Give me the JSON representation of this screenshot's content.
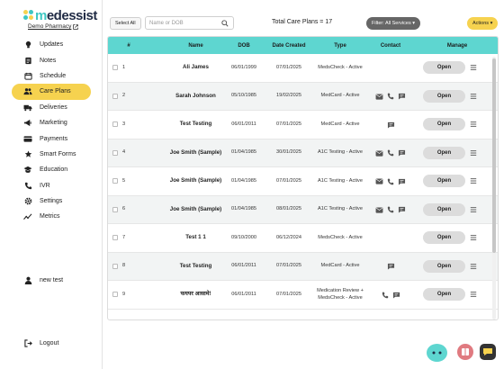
{
  "brand": {
    "logo_prefix": "m",
    "logo_rest": "edessist",
    "pharmacy": "Demo Pharmacy"
  },
  "sidebar": {
    "items": [
      {
        "label": "Updates",
        "icon": "bulb-icon"
      },
      {
        "label": "Notes",
        "icon": "notes-icon"
      },
      {
        "label": "Schedule",
        "icon": "calendar-icon"
      },
      {
        "label": "Care Plans",
        "icon": "people-icon",
        "active": true
      },
      {
        "label": "Deliveries",
        "icon": "truck-icon"
      },
      {
        "label": "Marketing",
        "icon": "megaphone-icon"
      },
      {
        "label": "Payments",
        "icon": "payment-icon"
      },
      {
        "label": "Smart Forms",
        "icon": "forms-icon"
      },
      {
        "label": "Education",
        "icon": "graduation-icon"
      },
      {
        "label": "IVR",
        "icon": "phone-icon"
      },
      {
        "label": "Settings",
        "icon": "gear-icon"
      },
      {
        "label": "Metrics",
        "icon": "metrics-icon"
      }
    ],
    "user": "new test",
    "logout": "Logout"
  },
  "toolbar": {
    "select_all": "Select All",
    "search_placeholder": "Name or DOB",
    "total": "Total Care Plans = 17",
    "filter": "Filter: All Services ▾",
    "actions": "Actions ▾"
  },
  "table": {
    "headers": [
      "#",
      "Name",
      "DOB",
      "Date Created",
      "Type",
      "Contact",
      "Manage"
    ],
    "open_label": "Open",
    "rows": [
      {
        "num": "1",
        "name": "Ali James",
        "dob": "06/01/1999",
        "created": "07/01/2025",
        "type": "MedsCheck - Active",
        "contact": []
      },
      {
        "num": "2",
        "name": "Sarah Johnson",
        "dob": "05/10/1985",
        "created": "19/02/2025",
        "type": "MedCard - Active",
        "contact": [
          "mail",
          "phone",
          "chat"
        ]
      },
      {
        "num": "3",
        "name": "Test Testing",
        "dob": "06/01/2011",
        "created": "07/01/2025",
        "type": "MedCard - Active",
        "contact": [
          "chat"
        ]
      },
      {
        "num": "4",
        "name": "Joe Smith (Sample)",
        "dob": "01/04/1985",
        "created": "30/01/2025",
        "type": "A1C Testing - Active",
        "contact": [
          "mail",
          "phone",
          "chat"
        ]
      },
      {
        "num": "5",
        "name": "Joe Smith (Sample)",
        "dob": "01/04/1985",
        "created": "07/01/2025",
        "type": "A1C Testing - Active",
        "contact": [
          "mail",
          "phone",
          "chat"
        ]
      },
      {
        "num": "6",
        "name": "Joe Smith (Sample)",
        "dob": "01/04/1985",
        "created": "08/01/2025",
        "type": "A1C Testing - Active",
        "contact": [
          "mail",
          "phone",
          "chat"
        ]
      },
      {
        "num": "7",
        "name": "Test 1 1",
        "dob": "09/10/2000",
        "created": "06/12/2024",
        "type": "MedsCheck - Active",
        "contact": []
      },
      {
        "num": "8",
        "name": "Test Testing",
        "dob": "06/01/2011",
        "created": "07/01/2025",
        "type": "MedCard - Active",
        "contact": [
          "chat"
        ]
      },
      {
        "num": "9",
        "name": "फयपर आसामे!",
        "dob": "06/01/2011",
        "created": "07/01/2025",
        "type": "Medication Review + MedsCheck - Active",
        "contact": [
          "phone",
          "chat"
        ]
      }
    ]
  },
  "colors": {
    "accent_teal": "#5ed6d0",
    "accent_yellow": "#f6d24f",
    "filter_gray": "#666666"
  }
}
